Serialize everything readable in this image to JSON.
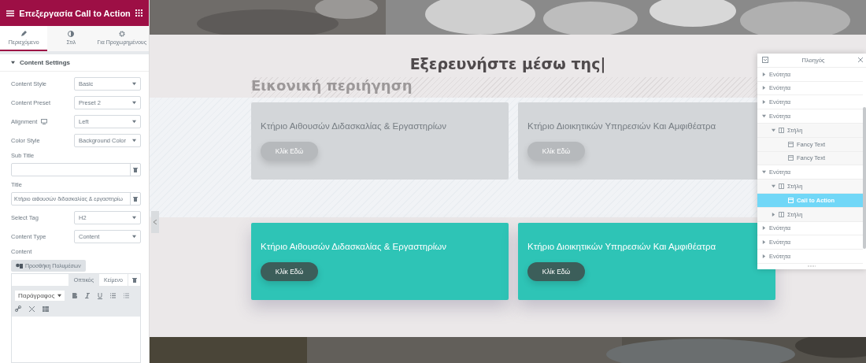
{
  "panel": {
    "title": "Επεξεργασία Call to Action",
    "tabs": [
      {
        "label": "Περιεχόμενο",
        "selected": true
      },
      {
        "label": "Στιλ",
        "selected": false
      },
      {
        "label": "Για Προχωρημένους",
        "selected": false
      }
    ],
    "section": {
      "title": "Content Settings",
      "expanded": true
    },
    "fields": [
      {
        "kind": "select",
        "label": "Content Style",
        "value": "Basic"
      },
      {
        "kind": "select",
        "label": "Content Preset",
        "value": "Preset 2"
      },
      {
        "kind": "select",
        "label": "Alignment",
        "value": "Left",
        "responsive": true
      },
      {
        "kind": "select",
        "label": "Color Style",
        "value": "Background Color"
      },
      {
        "kind": "text",
        "label": "Sub Title"
      },
      {
        "kind": "text",
        "label": "Title",
        "value": "Κτήριο αιθουσών διδασκαλίας & εργαστηρίω"
      },
      {
        "kind": "select",
        "label": "Select Tag",
        "value": "H2"
      },
      {
        "kind": "select",
        "label": "Content Type",
        "value": "Content"
      },
      {
        "kind": "editor",
        "label": "Content",
        "media_button": "Προσθήκη Πολυμέσων",
        "editor_tabs": [
          {
            "label": "Οπτικός",
            "selected": true
          },
          {
            "label": "Κείμενο",
            "selected": false
          }
        ],
        "format": "Παράγραφος"
      }
    ]
  },
  "canvas": {
    "heading": "Εξερευνήστε μέσω της|",
    "subheading": "Εικονική περιήγηση",
    "card_rows": [
      {
        "cards": [
          {
            "title": "Κτήριο Αιθουσών Διδασκαλίας & Εργαστηρίων",
            "button": "Κλίκ Εδώ"
          },
          {
            "title": "Κτήριο Διοικητικών Υπηρεσιών Και Αμφιθέατρα",
            "button": "Κλίκ Εδώ"
          }
        ]
      },
      {
        "cards": [
          {
            "title": "Κτήριο Αιθουσών Διδασκαλίας & Εργαστηρίων",
            "button": "Κλίκ Εδώ"
          },
          {
            "title": "Κτήριο Διοικητικών Υπηρεσιών Και Αμφιθέατρα",
            "button": "Κλίκ Εδώ"
          }
        ]
      }
    ]
  },
  "navigator": {
    "title": "Πλοηγός",
    "items": [
      {
        "kind": "section",
        "label": "Ενότητα",
        "expanded": false,
        "selected": false
      },
      {
        "kind": "section",
        "label": "Ενότητα",
        "expanded": false,
        "selected": false
      },
      {
        "kind": "section",
        "label": "Ενότητα",
        "expanded": false,
        "selected": false
      },
      {
        "kind": "section",
        "label": "Ενότητα",
        "expanded": true,
        "selected": false,
        "children": [
          {
            "kind": "column",
            "label": "Στήλη",
            "expanded": true,
            "selected": false,
            "children": [
              {
                "kind": "widget",
                "label": "Fancy Text",
                "selected": false
              },
              {
                "kind": "widget",
                "label": "Fancy Text",
                "selected": false
              }
            ]
          }
        ]
      },
      {
        "kind": "section",
        "label": "Ενότητα",
        "expanded": true,
        "selected": false,
        "children": [
          {
            "kind": "column",
            "label": "Στήλη",
            "expanded": true,
            "selected": false,
            "children": [
              {
                "kind": "widget",
                "label": "Call to Action",
                "selected": true
              }
            ]
          },
          {
            "kind": "column",
            "label": "Στήλη",
            "expanded": false,
            "selected": false
          }
        ]
      },
      {
        "kind": "section",
        "label": "Ενότητα",
        "expanded": false,
        "selected": false
      },
      {
        "kind": "section",
        "label": "Ενότητα",
        "expanded": false,
        "selected": false
      },
      {
        "kind": "section",
        "label": "Ενότητα",
        "expanded": false,
        "selected": false
      }
    ]
  }
}
